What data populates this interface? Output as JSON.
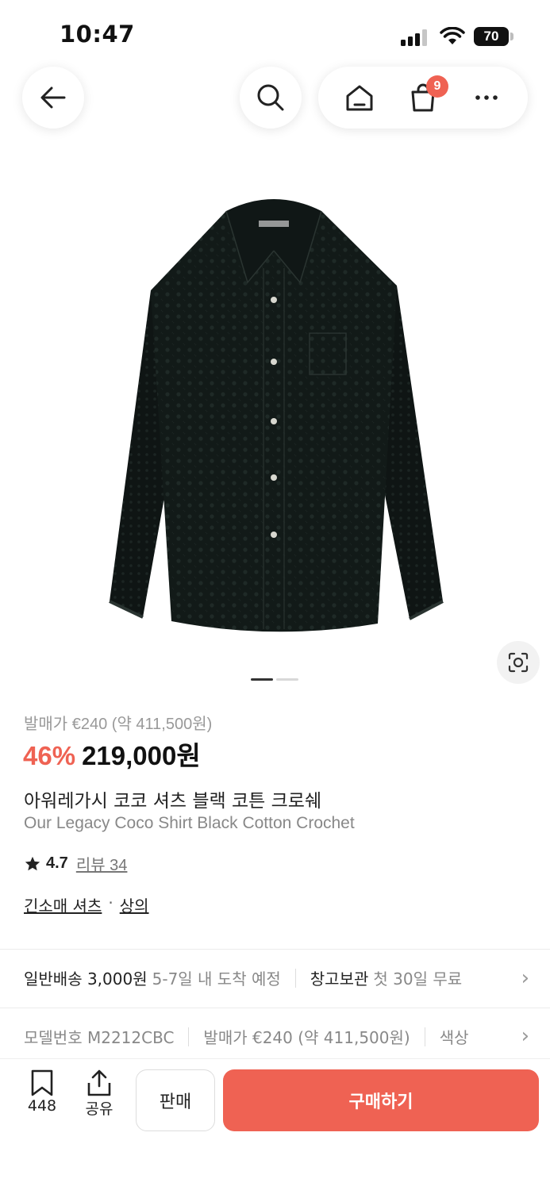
{
  "status_bar": {
    "time": "10:47",
    "battery": "70"
  },
  "nav": {
    "cart_count": "9"
  },
  "gallery": {
    "page_count": 2,
    "current_page": 1
  },
  "product": {
    "release_price": "발매가 €240 (약 411,500원)",
    "discount": "46%",
    "price": "219,000원",
    "name_ko": "아워레가시 코코 셔츠 블랙 코튼 크로쉐",
    "name_en": "Our Legacy Coco Shirt Black Cotton Crochet",
    "rating": "4.7",
    "review_label": "리뷰 34",
    "categories": [
      "긴소매 셔츠",
      "상의"
    ],
    "category_separator": "·"
  },
  "shipping": {
    "label": "일반배송 3,000원",
    "eta": "5-7일 내 도착 예정",
    "storage_label": "창고보관",
    "storage_note": "첫 30일 무료"
  },
  "specs": {
    "model": "모델번호 M2212CBC",
    "release": "발매가 €240 (약 411,500원)",
    "color": "색상"
  },
  "bottom_bar": {
    "wish_count": "448",
    "share_label": "공유",
    "sell_label": "판매",
    "buy_label": "구매하기"
  },
  "colors": {
    "accent": "#ef6253",
    "text": "#222222",
    "muted": "#888888"
  }
}
